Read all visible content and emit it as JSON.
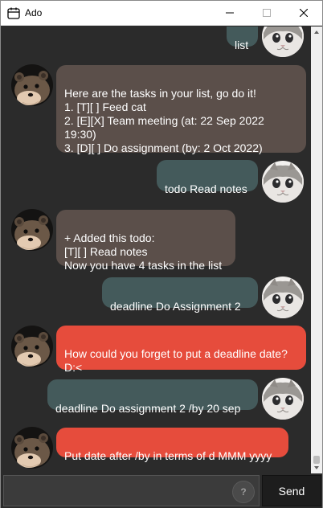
{
  "window": {
    "title": "Ado",
    "icon": "calendar-icon"
  },
  "controls": {
    "minimize": "minimize-icon",
    "maximize": "maximize-icon",
    "close": "close-icon"
  },
  "messages": [
    {
      "sender": "user",
      "text": "list"
    },
    {
      "sender": "ado",
      "text": "Here are the tasks in your list, go do it!\n1. [T][ ] Feed cat\n2. [E][X] Team meeting (at: 22 Sep 2022\n19:30)\n3. [D][ ] Do assignment (by: 2 Oct 2022)"
    },
    {
      "sender": "user",
      "text": "todo Read notes"
    },
    {
      "sender": "ado",
      "text": "+ Added this todo:\n[T][ ] Read notes\nNow you have 4 tasks in the list"
    },
    {
      "sender": "user",
      "text": "deadline Do Assignment 2"
    },
    {
      "sender": "ado",
      "style": "error",
      "text": "How could you forget to put a deadline date?\nD:<"
    },
    {
      "sender": "user",
      "text": "deadline Do assignment 2 /by 20 sep"
    },
    {
      "sender": "ado",
      "style": "error",
      "text": "Put date after /by in terms of d MMM yyyy"
    }
  ],
  "input": {
    "value": "",
    "help_label": "?",
    "send_label": "Send"
  },
  "colors": {
    "background": "#2b2b2b",
    "user_bubble": "#445a5b",
    "ado_bubble": "#5b4f4a",
    "error_bubble": "#e64c3c"
  }
}
